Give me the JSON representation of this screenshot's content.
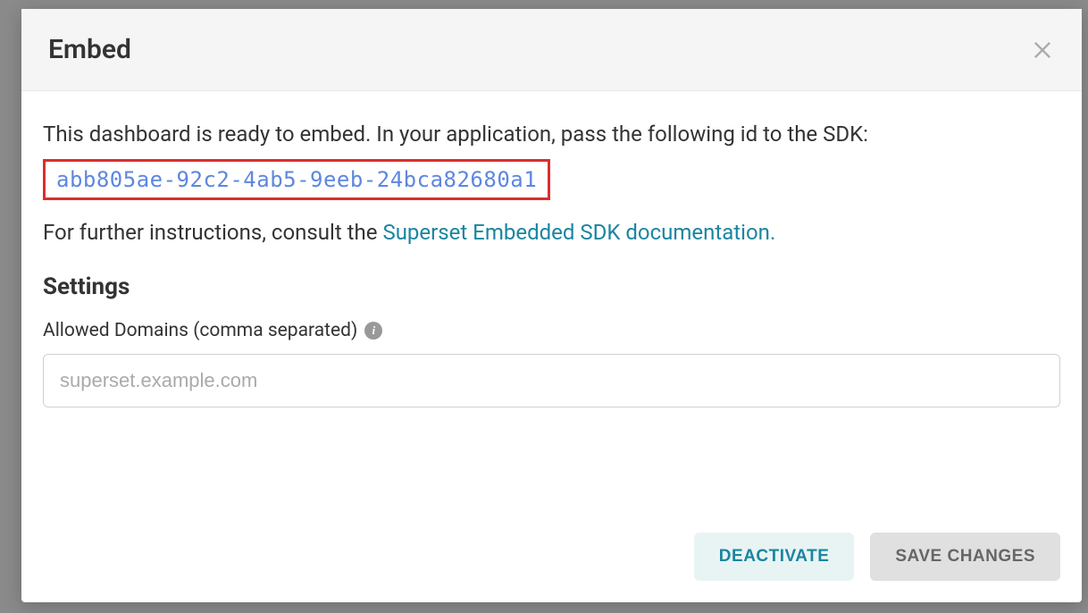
{
  "modal": {
    "title": "Embed",
    "intro": "This dashboard is ready to embed. In your application, pass the following id to the SDK:",
    "embed_id": "abb805ae-92c2-4ab5-9eeb-24bca82680a1",
    "instructions_prefix": "For further instructions, consult the ",
    "sdk_link_text": "Superset Embedded SDK documentation.",
    "settings_heading": "Settings",
    "domains_label": "Allowed Domains (comma separated)",
    "domains_placeholder": "superset.example.com",
    "domains_value": ""
  },
  "footer": {
    "deactivate_label": "DEACTIVATE",
    "save_label": "SAVE CHANGES"
  }
}
